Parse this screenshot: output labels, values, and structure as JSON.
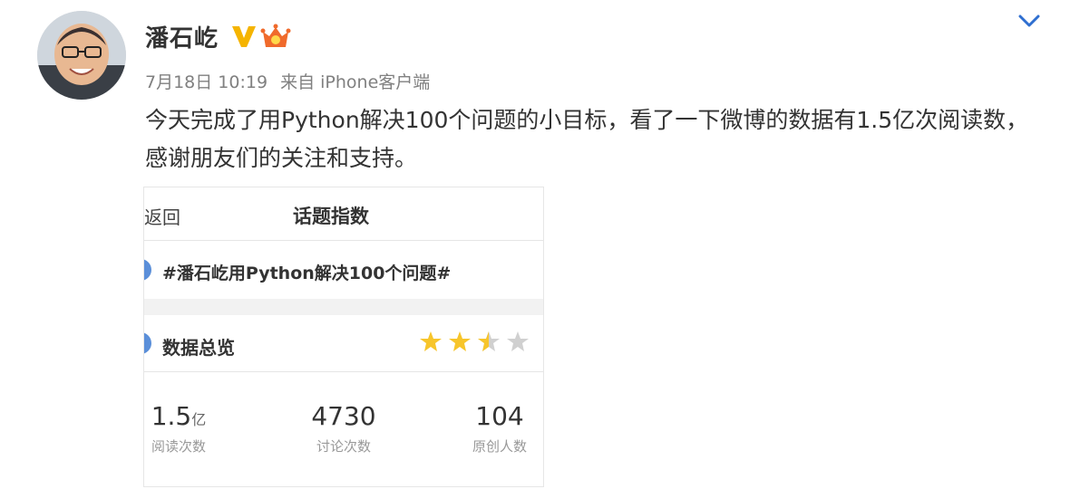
{
  "post": {
    "author": "潘石屹",
    "timestamp": "7月18日 10:19",
    "source": "来自 iPhone客户端",
    "text": "今天完成了用Python解决100个问题的小目标，看了一下微博的数据有1.5亿次阅读数，感谢朋友们的关注和支持。"
  },
  "icons": {
    "verified": "verified-v-icon",
    "member": "member-crown-icon",
    "menu": "chevron-down-icon"
  },
  "colors": {
    "verified": "#f5b400",
    "member": "#f06a2b",
    "accent": "#5b8fd9",
    "star_filled": "#f7c52b",
    "star_empty": "#d0d0d0"
  },
  "embed": {
    "back_label": "返回",
    "title": "话题指数",
    "topic": "#潘石屹用Python解决100个问题#",
    "overview_label": "数据总览",
    "rating_stars": 2.5,
    "stats": [
      {
        "value": "1.5",
        "unit": "亿",
        "label": "阅读次数"
      },
      {
        "value": "4730",
        "unit": "",
        "label": "讨论次数"
      },
      {
        "value": "104",
        "unit": "",
        "label": "原创人数"
      }
    ]
  }
}
